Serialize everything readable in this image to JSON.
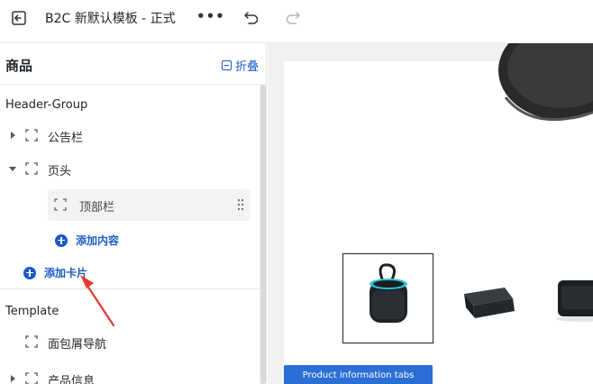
{
  "topbar": {
    "title": "B2C 新默认模板 - 正式",
    "more_label": "•••"
  },
  "panel": {
    "title": "商品",
    "collapse_label": "折叠",
    "header_group_label": "Header-Group",
    "items": [
      {
        "label": "公告栏"
      },
      {
        "label": "页头"
      }
    ],
    "sub_item_label": "顶部栏",
    "add_content_label": "添加内容",
    "add_card_label": "添加卡片",
    "template_label": "Template",
    "template_items": [
      {
        "label": "面包屑导航"
      },
      {
        "label": "产品信息"
      }
    ]
  },
  "preview": {
    "tab_button_label": "Product information tabs"
  },
  "colors": {
    "accent": "#1a5bc4",
    "annotation_arrow": "#e53935",
    "tab_button": "#2b6ed6"
  }
}
